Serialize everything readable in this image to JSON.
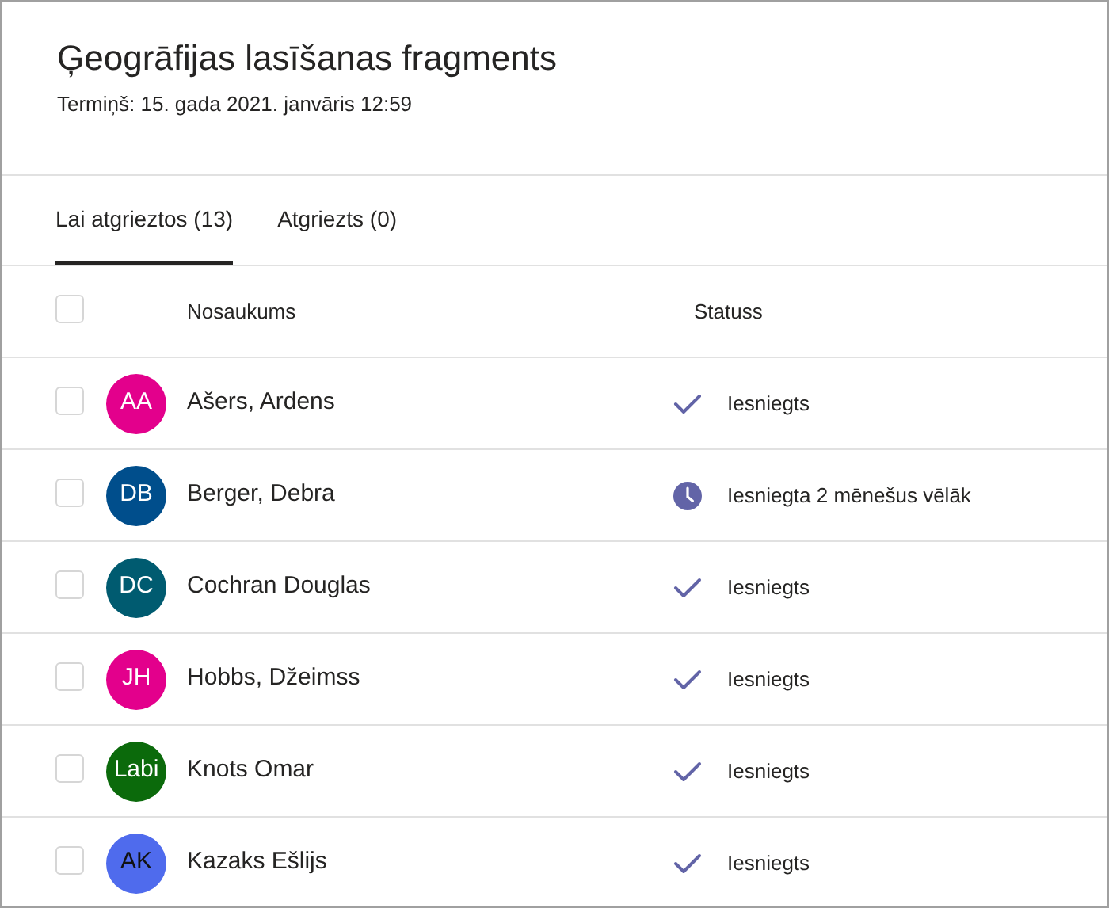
{
  "title": "Ģeogrāfijas lasīšanas fragments",
  "due": "Termiņš: 15. gada 2021. janvāris 12:59",
  "tabs": [
    {
      "label": "Lai atgrieztos (13)",
      "selected": true
    },
    {
      "label": "Atgriezts (0)",
      "selected": false
    }
  ],
  "table": {
    "select_all": {
      "checked": false
    },
    "columns": [
      "Nosaukums",
      "Statuss"
    ],
    "rows": [
      {
        "checked": false,
        "initials": "AA",
        "color": "#e3008c",
        "name": "Ašers, Ardens",
        "kind": "submitted",
        "status": "Iesniegts"
      },
      {
        "checked": false,
        "initials": "DB",
        "color": "#004e8c",
        "name": "Berger, Debra",
        "kind": "late",
        "status": "Iesniegta 2 mēnešus vēlāk"
      },
      {
        "checked": false,
        "initials": "DC",
        "color": "#005b70",
        "name": "Cochran Douglas",
        "kind": "submitted",
        "status": "Iesniegts"
      },
      {
        "checked": false,
        "initials": "JH",
        "color": "#e3008c",
        "name": "Hobbs, Džeimss",
        "kind": "submitted",
        "status": "Iesniegts"
      },
      {
        "checked": false,
        "initials": "Labi",
        "color": "#0b6a0b",
        "name": "Knots Omar",
        "kind": "submitted",
        "status": "Iesniegts"
      },
      {
        "checked": false,
        "initials": "AK",
        "color": "#4f6bed",
        "name": "Kazaks Ešlijs",
        "kind": "submitted",
        "status": "Iesniegts"
      }
    ]
  }
}
